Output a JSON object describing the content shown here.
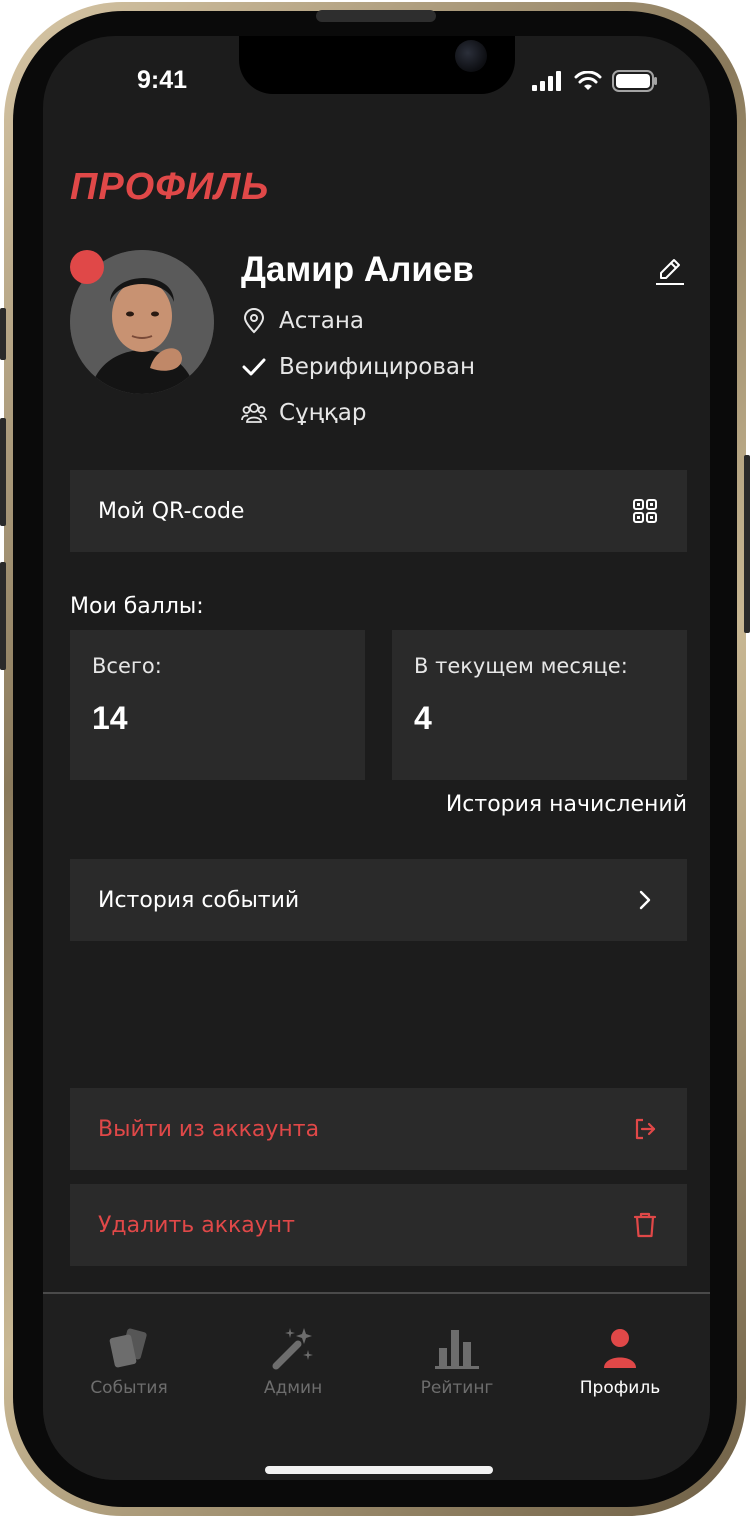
{
  "status": {
    "time": "9:41",
    "icons": [
      "cellular-signal-icon",
      "wifi-icon",
      "battery-icon"
    ]
  },
  "page": {
    "title": "ПРОФИЛЬ"
  },
  "profile": {
    "name": "Дамир Алиев",
    "city": "Астана",
    "verification": "Верифицирован",
    "group": "Сұңқар",
    "online_indicator_color": "#e04848"
  },
  "qr_card": {
    "label": "Мой QR-code",
    "icon": "qr-code-icon"
  },
  "points": {
    "section_label": "Мои баллы:",
    "total_label": "Всего:",
    "total_value": "14",
    "month_label": "В текущем месяце:",
    "month_value": "4",
    "history_link": "История начислений"
  },
  "events_card": {
    "label": "История событий",
    "icon": "chevron-right-icon"
  },
  "logout_card": {
    "label": "Выйти из аккаунта",
    "icon": "logout-icon"
  },
  "delete_card": {
    "label": "Удалить аккаунт",
    "icon": "trash-icon"
  },
  "tabbar": {
    "items": [
      {
        "label": "События",
        "icon": "cards-icon",
        "active": false
      },
      {
        "label": "Админ",
        "icon": "magic-wand-icon",
        "active": false
      },
      {
        "label": "Рейтинг",
        "icon": "bar-chart-icon",
        "active": false
      },
      {
        "label": "Профиль",
        "icon": "user-icon",
        "active": true
      }
    ]
  },
  "colors": {
    "accent": "#e04848",
    "background": "#1c1c1c",
    "card": "#2a2a2a",
    "inactive": "#6d6d6d"
  }
}
